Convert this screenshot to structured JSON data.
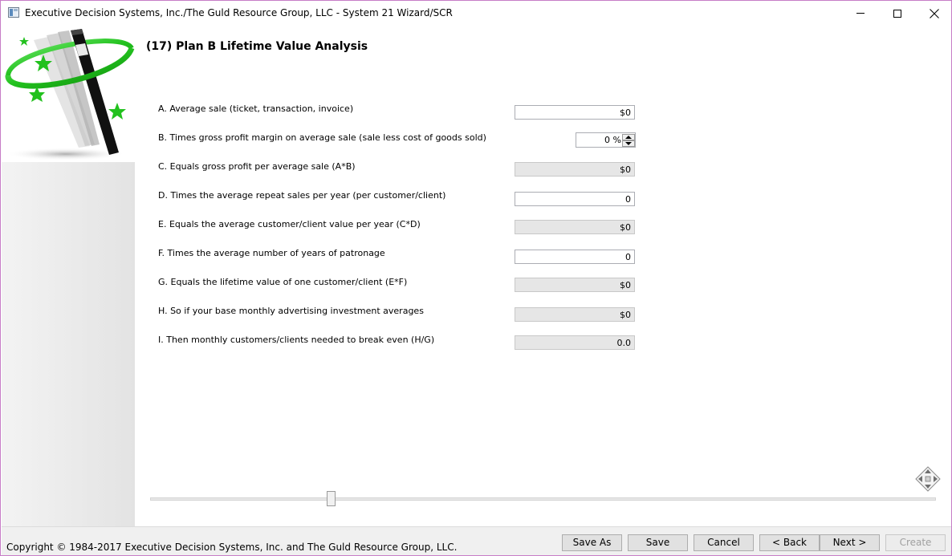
{
  "window": {
    "title": "Executive Decision Systems, Inc./The Guld Resource Group, LLC - System 21 Wizard/SCR"
  },
  "page": {
    "title": "(17) Plan B Lifetime Value Analysis"
  },
  "rows": [
    {
      "label": "A. Average sale (ticket, transaction, invoice)",
      "value": "$0"
    },
    {
      "label": "B. Times gross profit margin on average sale (sale less cost of goods sold)",
      "value": "0 %"
    },
    {
      "label": "C. Equals gross profit per average sale (A*B)",
      "value": "$0"
    },
    {
      "label": "D. Times the average repeat sales per year (per customer/client)",
      "value": "0"
    },
    {
      "label": "E. Equals the average customer/client value per year (C*D)",
      "value": "$0"
    },
    {
      "label": "F. Times the average number of years of patronage",
      "value": "0"
    },
    {
      "label": "G. Equals the lifetime value of one customer/client (E*F)",
      "value": "$0"
    },
    {
      "label": "H. So if your base monthly advertising investment averages",
      "value": "$0"
    },
    {
      "label": "I. Then monthly customers/clients needed to break even (H/G)",
      "value": "0.0"
    }
  ],
  "footer": {
    "copyright": "Copyright © 1984-2017 Executive Decision Systems, Inc. and The Guld Resource Group, LLC.",
    "buttons": {
      "save_as": "Save As",
      "save": "Save",
      "cancel": "Cancel",
      "back": "< Back",
      "next": "Next >",
      "create": "Create"
    }
  },
  "colors": {
    "banner_green": "#22c11e",
    "wand_black": "#111111",
    "window_border": "#c77dc7"
  },
  "icons": {
    "app": "app-icon",
    "wand": "magic-wand-icon",
    "move": "move-arrows-icon"
  }
}
